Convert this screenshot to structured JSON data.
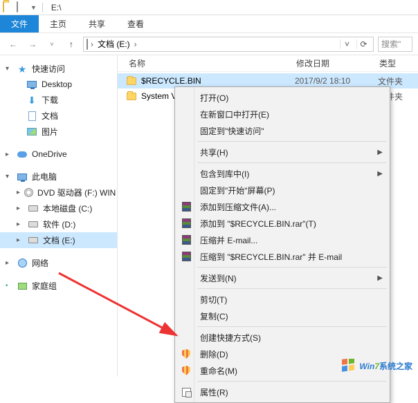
{
  "titlebar": {
    "title": "E:\\"
  },
  "ribbon": {
    "file": "文件",
    "home": "主页",
    "share": "共享",
    "view": "查看"
  },
  "address": {
    "root": "文档 (E:)",
    "search_placeholder": "搜索\""
  },
  "sidebar": {
    "quick_access": "快速访问",
    "desktop": "Desktop",
    "downloads": "下载",
    "documents": "文档",
    "pictures": "图片",
    "onedrive": "OneDrive",
    "this_pc": "此电脑",
    "dvd": "DVD 驱动器 (F:) WIN",
    "disk_c": "本地磁盘 (C:)",
    "disk_d": "软件 (D:)",
    "disk_e": "文档 (E:)",
    "network": "网络",
    "homegroup": "家庭组"
  },
  "columns": {
    "name": "名称",
    "date": "修改日期",
    "type": "类型"
  },
  "files": [
    {
      "name": "$RECYCLE.BIN",
      "date": "2017/9/2 18:10",
      "type": "文件夹"
    },
    {
      "name": "System V",
      "date": "",
      "type": "文件夹"
    }
  ],
  "context_menu": {
    "open": "打开(O)",
    "open_new_window": "在新窗口中打开(E)",
    "pin_quick_access": "固定到\"快速访问\"",
    "share": "共享(H)",
    "include_in_library": "包含到库中(I)",
    "pin_to_start": "固定到\"开始\"屏幕(P)",
    "add_to_archive": "添加到压缩文件(A)...",
    "add_to_rar": "添加到 \"$RECYCLE.BIN.rar\"(T)",
    "compress_email": "压缩并 E-mail...",
    "compress_rar_email": "压缩到 \"$RECYCLE.BIN.rar\" 并 E-mail",
    "send_to": "发送到(N)",
    "cut": "剪切(T)",
    "copy": "复制(C)",
    "create_shortcut": "创建快捷方式(S)",
    "delete": "删除(D)",
    "rename": "重命名(M)",
    "properties": "属性(R)"
  },
  "watermark": {
    "brand_win": "Win",
    "brand_seven": "7",
    "brand_cn": "系统之家"
  }
}
